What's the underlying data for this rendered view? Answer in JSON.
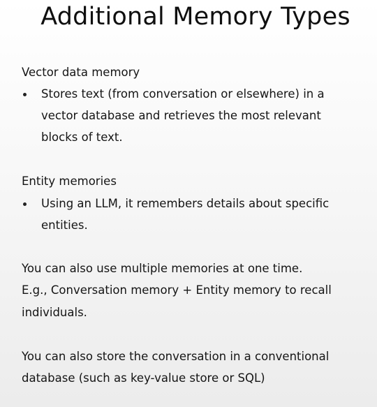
{
  "title": "Additional Memory Types",
  "sections": {
    "vector": {
      "heading": "Vector data memory",
      "bullet_lines": [
        "Stores text (from conversation or elsewhere) in a",
        "vector database and retrieves the most relevant",
        "blocks of text."
      ]
    },
    "entity": {
      "heading": "Entity memories",
      "bullet_lines": [
        "Using an LLM, it remembers details about specific",
        "entities."
      ]
    },
    "multiple": {
      "lines": [
        "You can also use multiple memories at one time.",
        "E.g., Conversation memory + Entity memory to recall",
        "individuals."
      ]
    },
    "storage": {
      "lines": [
        "You can also store the conversation in a conventional",
        "database (such as key-value store or SQL)"
      ]
    }
  }
}
